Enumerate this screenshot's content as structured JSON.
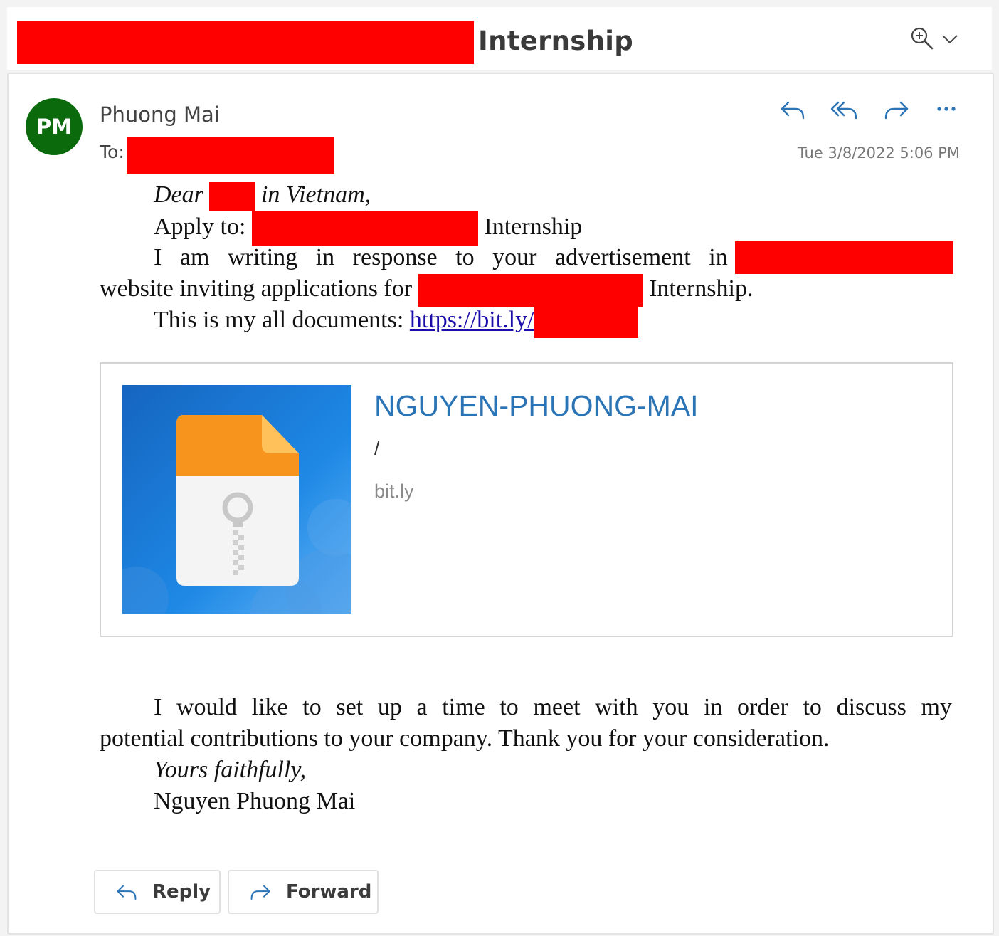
{
  "subject": {
    "title": "Internship"
  },
  "sender": {
    "initials": "PM",
    "name": "Phuong Mai",
    "to_label": "To:",
    "timestamp": "Tue 3/8/2022 5:06 PM"
  },
  "body": {
    "dear_prefix": "Dear",
    "dear_suffix": "in Vietnam,",
    "apply_label": "Apply to:",
    "apply_suffix": "Internship",
    "line3_words": [
      "I",
      "am",
      "writing",
      "in",
      "response",
      "to",
      "your",
      "advertisement",
      "in"
    ],
    "line4_prefix": "website inviting applications for",
    "line4_suffix": "Internship.",
    "docs_prefix": "This is my all documents:",
    "docs_link": "https://bit.ly/",
    "para2_line1_words": [
      "I",
      "would",
      "like",
      "to",
      "set",
      "up",
      "a",
      "time",
      "to",
      "meet",
      "with",
      "you",
      "in",
      "order",
      "to",
      "discuss",
      "my"
    ],
    "para2_line2": "potential contributions to your company. Thank you for your consideration.",
    "closing": "Yours faithfully,",
    "signature": "Nguyen Phuong Mai"
  },
  "preview": {
    "title": "NGUYEN-PHUONG-MAI",
    "path": "/",
    "domain": "bit.ly"
  },
  "buttons": {
    "reply_label": "Reply",
    "forward_label": "Forward"
  },
  "colors": {
    "avatar": "#0b6a0b",
    "accent": "#2b74b5",
    "redaction": "#ff0000"
  }
}
